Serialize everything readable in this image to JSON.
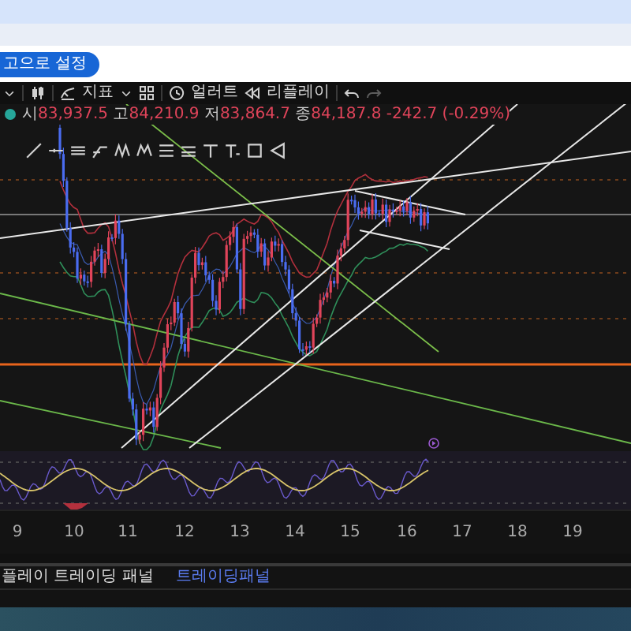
{
  "browser": {
    "button": "고으로 설정"
  },
  "toolbar": {
    "indicators": "지표",
    "alerts": "얼러트",
    "replay": "리플레이"
  },
  "chart": {
    "ohlc": [
      {
        "label": "시",
        "value": "83,937.5"
      },
      {
        "label": "고",
        "value": "84,210.9"
      },
      {
        "label": "저",
        "value": "83,864.7"
      },
      {
        "label": "종",
        "value": "84,187.8"
      }
    ],
    "change": "-242.7 (-0.29%)",
    "x_axis": [
      "9",
      "10",
      "11",
      "12",
      "13",
      "14",
      "15",
      "16",
      "17",
      "18",
      "19"
    ]
  },
  "bottom_panel": {
    "title": "플레이 트레이딩 패널",
    "link": "트레이딩패널"
  }
}
